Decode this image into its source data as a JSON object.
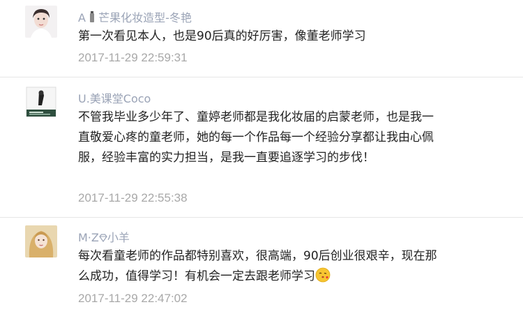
{
  "comments": [
    {
      "name_prefix": "A",
      "name": "芒果化妆造型-冬艳",
      "text": "第一次看见本人，也是90后真的好厉害，像董老师学习",
      "time": "2017-11-29 22:59:31",
      "avatar_icon": "portrait-avatar-woman"
    },
    {
      "name": "U.美课堂Coco",
      "text": "不管我毕业多少年了、童婷老师都是我化妆届的启蒙老师，也是我一直敬爱心疼的童老师，她的每一个作品每一个经验分享都让我由心佩服，经验丰富的实力担当，是我一直要追逐学习的步伐！",
      "time": "2017-11-29 22:55:38",
      "avatar_icon": "book-cover-avatar"
    },
    {
      "name_prefix": "M·Z",
      "name": "小羊",
      "text": "每次看童老师的作品都特别喜欢，很高端，90后创业很艰辛，现在那么成功，值得学习！有机会一定去跟老师学习",
      "time": "2017-11-29 22:47:02",
      "avatar_icon": "portrait-avatar-blonde",
      "trailing_emoji": "kiss-emoji"
    }
  ]
}
